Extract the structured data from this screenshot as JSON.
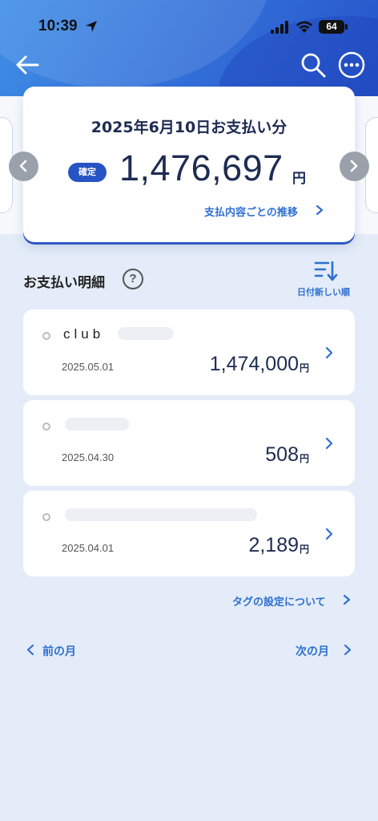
{
  "status_bar": {
    "time": "10:39",
    "battery": "64"
  },
  "summary": {
    "title": "2025年6月10日お支払い分",
    "badge": "確定",
    "amount": "1,476,697",
    "unit": "円",
    "trend_link": "支払内容ごとの推移"
  },
  "section": {
    "title": "お支払い明細",
    "help": "?",
    "sort_label": "日付新しい順"
  },
  "transactions": [
    {
      "name": "club",
      "date": "2025.05.01",
      "amount": "1,474,000",
      "unit": "円"
    },
    {
      "name": "",
      "date": "2025.04.30",
      "amount": "508",
      "unit": "円"
    },
    {
      "name": "",
      "date": "2025.04.01",
      "amount": "2,189",
      "unit": "円"
    }
  ],
  "tag_link": "タグの設定について",
  "pager": {
    "prev": "前の月",
    "next": "次の月"
  },
  "colors": {
    "accent": "#2f6fd0",
    "badge": "#2754c4",
    "header": "#3574db",
    "background": "#e3ecf8"
  }
}
